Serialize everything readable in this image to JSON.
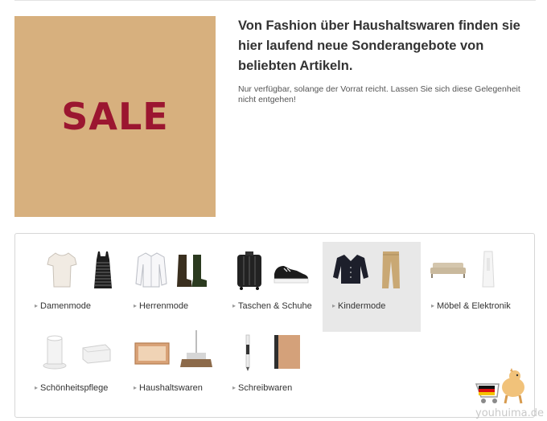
{
  "banner": {
    "text": "SALE",
    "background_color": "#d7b07e",
    "text_color": "#9b1630"
  },
  "promo": {
    "headline": "Von Fashion über Haushaltswaren finden sie hier laufend neue Sonderangebote von beliebten Artikeln.",
    "subtext": "Nur verfügbar, solange der Vorrat reicht. Lassen Sie sich diese Gelegenheit nicht entgehen!"
  },
  "categories": [
    {
      "label": "Damenmode",
      "icons": [
        "tshirt-icon",
        "striped-dress-icon"
      ],
      "active": false
    },
    {
      "label": "Herrenmode",
      "icons": [
        "shirt-icon",
        "boots-icon"
      ],
      "active": false
    },
    {
      "label": "Taschen & Schuhe",
      "icons": [
        "suitcase-icon",
        "sneakers-icon"
      ],
      "active": false
    },
    {
      "label": "Kindermode",
      "icons": [
        "cardigan-icon",
        "trousers-icon"
      ],
      "active": true
    },
    {
      "label": "Möbel & Elektronik",
      "icons": [
        "sofa-icon",
        "lamp-icon"
      ],
      "active": false
    },
    {
      "label": "Schönheitspflege",
      "icons": [
        "diffuser-icon",
        "storage-box-icon"
      ],
      "active": false
    },
    {
      "label": "Haushaltswaren",
      "icons": [
        "wooden-crate-icon",
        "broom-icon"
      ],
      "active": false
    },
    {
      "label": "Schreibwaren",
      "icons": [
        "pen-icon",
        "notebook-icon"
      ],
      "active": false
    }
  ],
  "watermark": {
    "text": "youhuima.de"
  }
}
